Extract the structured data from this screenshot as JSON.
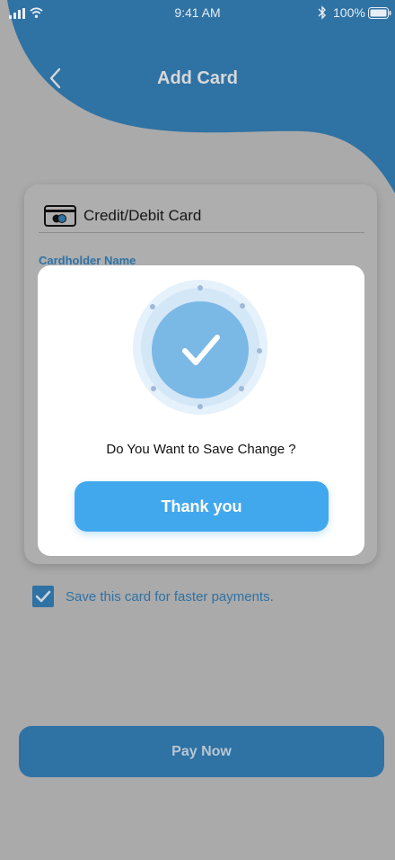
{
  "status_bar": {
    "time": "9:41 AM",
    "battery": "100%",
    "icons": [
      "signal-icon",
      "wifi-icon",
      "bluetooth-icon",
      "battery-icon"
    ]
  },
  "header": {
    "title": "Add Card",
    "back_icon": "chevron-left-icon"
  },
  "card_form": {
    "card_type_icon": "credit-card-icon",
    "card_type_label": "Credit/Debit Card",
    "cardholder_label": "Cardholder Name"
  },
  "save_option": {
    "checked": true,
    "label": "Save this card for faster payments."
  },
  "pay_button": {
    "label": "Pay Now"
  },
  "modal": {
    "icon": "checkmark-icon",
    "message": "Do You Want to Save Change ?",
    "button_label": "Thank you"
  },
  "colors": {
    "brand_blue": "#2f72a4",
    "accent_blue": "#42a8ee",
    "success_circle": "#7ab8e6",
    "overlay_gray": "#aaaaaa"
  }
}
